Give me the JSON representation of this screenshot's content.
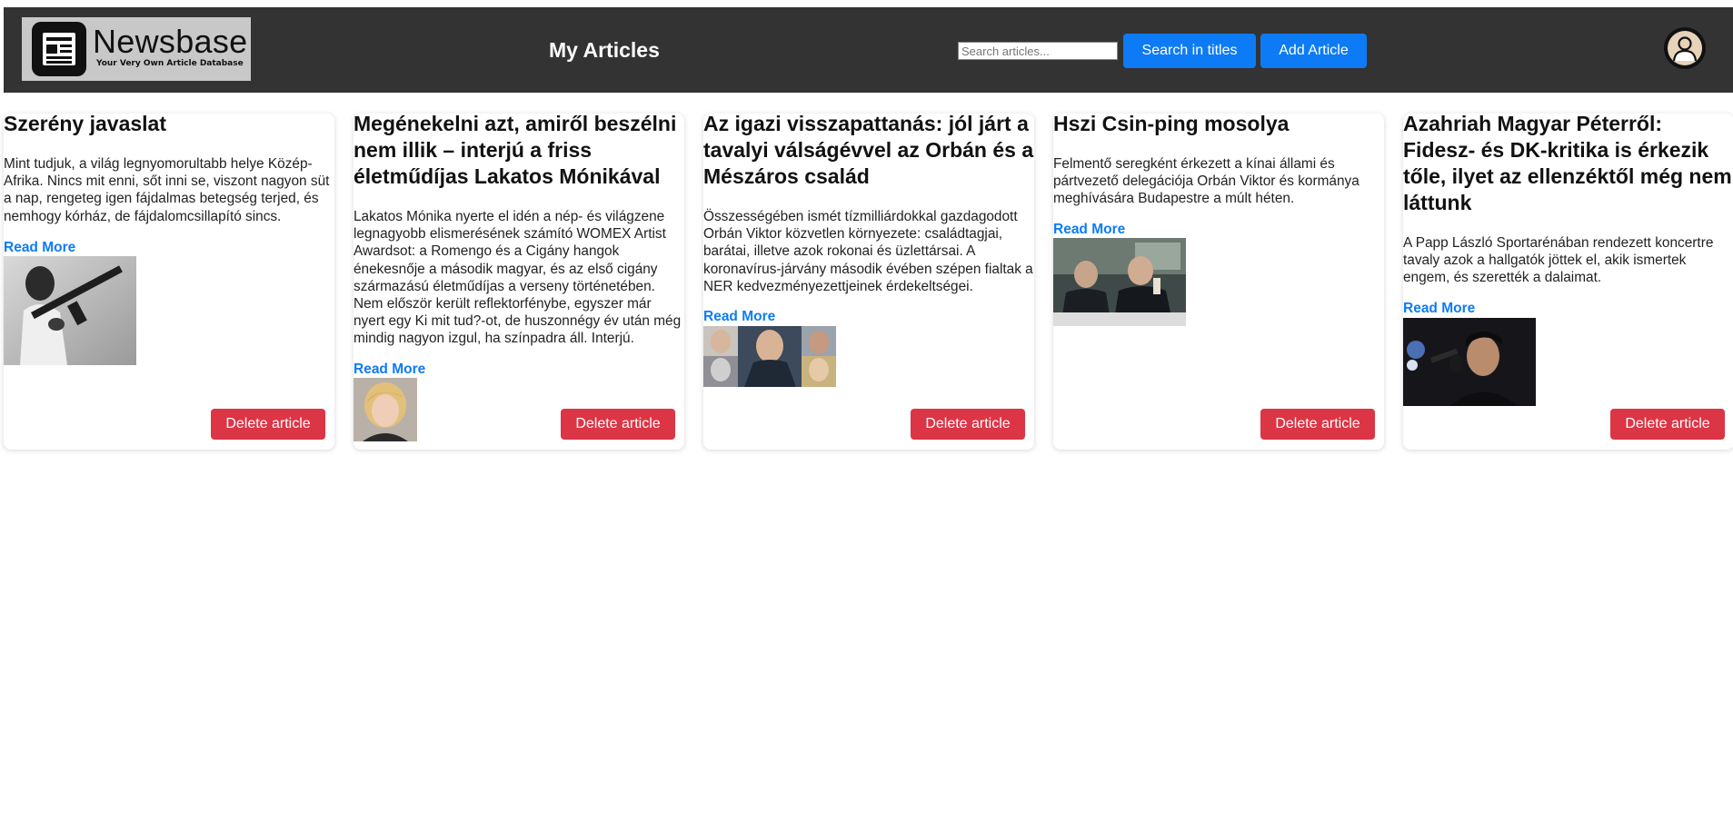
{
  "header": {
    "logo": {
      "title": "Newsbase",
      "tagline": "Your Very Own Article Database"
    },
    "page_title": "My Articles",
    "search": {
      "value": "",
      "placeholder": "Search articles..."
    },
    "search_titles_label": "Search in titles",
    "add_article_label": "Add Article",
    "avatar_icon": "user-avatar-icon"
  },
  "colors": {
    "header_bg": "#333333",
    "primary": "#0d7bf6",
    "danger": "#dc3545"
  },
  "articles": [
    {
      "title": "Szerény javaslat",
      "description": "Mint tudjuk, a világ legnyomorultabb helye Közép-Afrika. Nincs mit enni, sőt inni se, viszont nagyon süt a nap, rengeteg igen fájdalmas betegség terjed, és nemhogy kórház, de fájdalomcsillapító sincs.",
      "read_more": "Read More",
      "delete_label": "Delete article",
      "thumbnail": "grayscale photo of a boy holding a rifle"
    },
    {
      "title": "Megénekelni azt, amiről beszélni nem illik – interjú a friss életműdíjas Lakatos Mónikával",
      "description": "Lakatos Mónika nyerte el idén a nép- és világzene legnagyobb elismerésének számító WOMEX Artist Awardsot: a Romengo és a Cigány hangok énekesnője a második magyar, és az első cigány származású életműdíjas a verseny történetében. Nem először került reflektorfénybe, egyszer már nyert egy Ki mit tud?-ot, de huszonnégy év után még mindig nagyon izgul, ha színpadra áll. Interjú.",
      "read_more": "Read More",
      "delete_label": "Delete article",
      "thumbnail": "portrait of a blonde woman"
    },
    {
      "title": "Az igazi visszapattanás: jól járt a tavalyi válságévvel az Orbán és a Mészáros család",
      "description": "Összességében ismét tízmilliárdokkal gazdagodott Orbán Viktor közvetlen környezete: családtagjai, barátai, illetve azok rokonai és üzlettársai. A koronavírus-járvány második évében szépen fialtak a NER kedvezményezettjeinek érdekeltségei.",
      "read_more": "Read More",
      "delete_label": "Delete article",
      "thumbnail": "photo collage of several men and a woman"
    },
    {
      "title": "Hszi Csin-ping mosolya",
      "description": "Felmentő seregként érkezett a kínai állami és pártvezető delegációja Orbán Viktor és kormánya meghívására Budapestre a múlt héten.",
      "read_more": "Read More",
      "delete_label": "Delete article",
      "thumbnail": "two men talking at a table"
    },
    {
      "title": "Azahriah Magyar Péterről: Fidesz- és DK-kritika is érkezik tőle, ilyet az ellenzéktől még nem láttunk",
      "description": "A Papp László Sportarénában rendezett koncertre tavaly azok a hallgatók jöttek el, akik ismertek engem, és szerették a dalaimat.",
      "read_more": "Read More",
      "delete_label": "Delete article",
      "thumbnail": "man in a cap at a microphone in a studio"
    }
  ]
}
